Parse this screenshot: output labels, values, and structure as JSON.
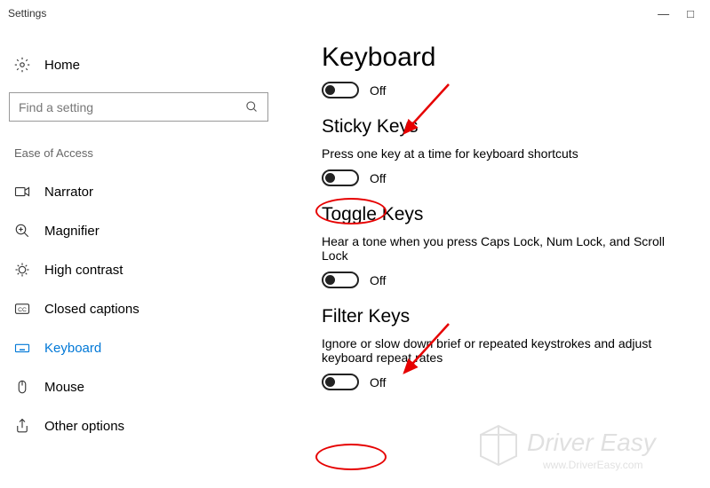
{
  "window": {
    "title": "Settings"
  },
  "sidebar": {
    "home_label": "Home",
    "search_placeholder": "Find a setting",
    "section_label": "Ease of Access",
    "items": [
      {
        "label": "Narrator"
      },
      {
        "label": "Magnifier"
      },
      {
        "label": "High contrast"
      },
      {
        "label": "Closed captions"
      },
      {
        "label": "Keyboard"
      },
      {
        "label": "Mouse"
      },
      {
        "label": "Other options"
      }
    ]
  },
  "content": {
    "title": "Keyboard",
    "main_toggle_state": "Off",
    "sections": [
      {
        "heading": "Sticky Keys",
        "desc": "Press one key at a time for keyboard shortcuts",
        "state": "Off"
      },
      {
        "heading": "Toggle Keys",
        "desc": "Hear a tone when you press Caps Lock, Num Lock, and Scroll Lock",
        "state": "Off"
      },
      {
        "heading": "Filter Keys",
        "desc": "Ignore or slow down brief or repeated keystrokes and adjust keyboard repeat rates",
        "state": "Off"
      }
    ]
  },
  "watermark": {
    "brand": "Driver Easy",
    "url": "www.DriverEasy.com"
  }
}
